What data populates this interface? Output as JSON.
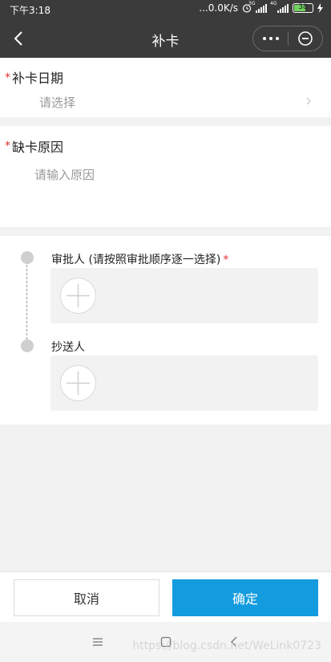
{
  "status_bar": {
    "time": "下午3:18",
    "network_speed": "...0.0K/s",
    "net_type_1": "3G",
    "net_type_2": "4G",
    "battery": "38"
  },
  "navbar": {
    "title": "补卡"
  },
  "form": {
    "date": {
      "label": "补卡日期",
      "required_mark": "*",
      "placeholder": "请选择"
    },
    "reason": {
      "label": "缺卡原因",
      "required_mark": "*",
      "placeholder": "请输入原因"
    }
  },
  "flow": {
    "approver": {
      "label": "审批人 (请按照审批顺序逐一选择)",
      "required_mark": "*"
    },
    "cc": {
      "label": "抄送人"
    }
  },
  "actions": {
    "cancel": "取消",
    "confirm": "确定"
  },
  "watermark": "https://blog.csdn.net/WeLink0723",
  "colors": {
    "primary": "#129bdf",
    "required": "#e0312f",
    "header": "#3b3b3b"
  }
}
